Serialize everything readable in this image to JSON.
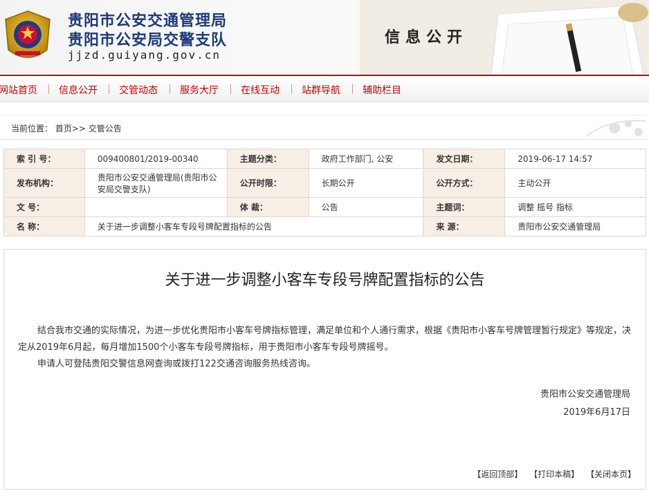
{
  "header": {
    "title_line1": "贵阳市公安交通管理局",
    "title_line2": "贵阳市公安局交警支队",
    "domain": "jjzd.guiyang.gov.cn",
    "section_label": "信息公开"
  },
  "nav": {
    "items": [
      "网站首页",
      "信息公开",
      "交管动态",
      "服务大厅",
      "在线互动",
      "站群导航",
      "辅助栏目"
    ]
  },
  "breadcrumb": {
    "prefix": "当前位置：",
    "home": "首页",
    "separator": ">>",
    "current": "交管公告"
  },
  "meta": {
    "index_label": "索 引 号：",
    "index_value": "009400801/2019-00340",
    "category_label": "主题分类：",
    "category_value": "政府工作部门, 公安",
    "date_label": "发文日期：",
    "date_value": "2019-06-17 14:57",
    "publisher_label": "发布机构：",
    "publisher_value": "贵阳市公安交通管理局(贵阳市公安局交警支队)",
    "open_period_label": "公开时限：",
    "open_period_value": "长期公开",
    "open_mode_label": "公开方式：",
    "open_mode_value": "主动公开",
    "doc_no_label": "文 号：",
    "doc_no_value": "",
    "genre_label": "体 裁：",
    "genre_value": "公告",
    "keywords_label": "主题词：",
    "keywords_value": "调整 摇号 指标",
    "name_label": "名 称：",
    "name_value": "关于进一步调整小客车专段号牌配置指标的公告",
    "source_label": "来 源：",
    "source_value": "贵阳市公安交通管理局"
  },
  "article": {
    "title": "关于进一步调整小客车专段号牌配置指标的公告",
    "paragraph1": "结合我市交通的实际情况，为进一步优化贵阳市小客车号牌指标管理，满足单位和个人通行需求，根据《贵阳市小客车号牌管理暂行规定》等规定，决定从2019年6月起，每月增加1500个小客车专段号牌指标，用于贵阳市小客车专段号牌摇号。",
    "paragraph2": "申请人可登陆贵阳交警信息网查询或拨打122交通咨询服务热线咨询。",
    "signature": "贵阳市公安交通管理局",
    "sign_date": "2019年6月17日"
  },
  "footer": {
    "back_top": "【返回顶部】",
    "print": "【打印本稿】",
    "close": "【关闭本页】"
  }
}
